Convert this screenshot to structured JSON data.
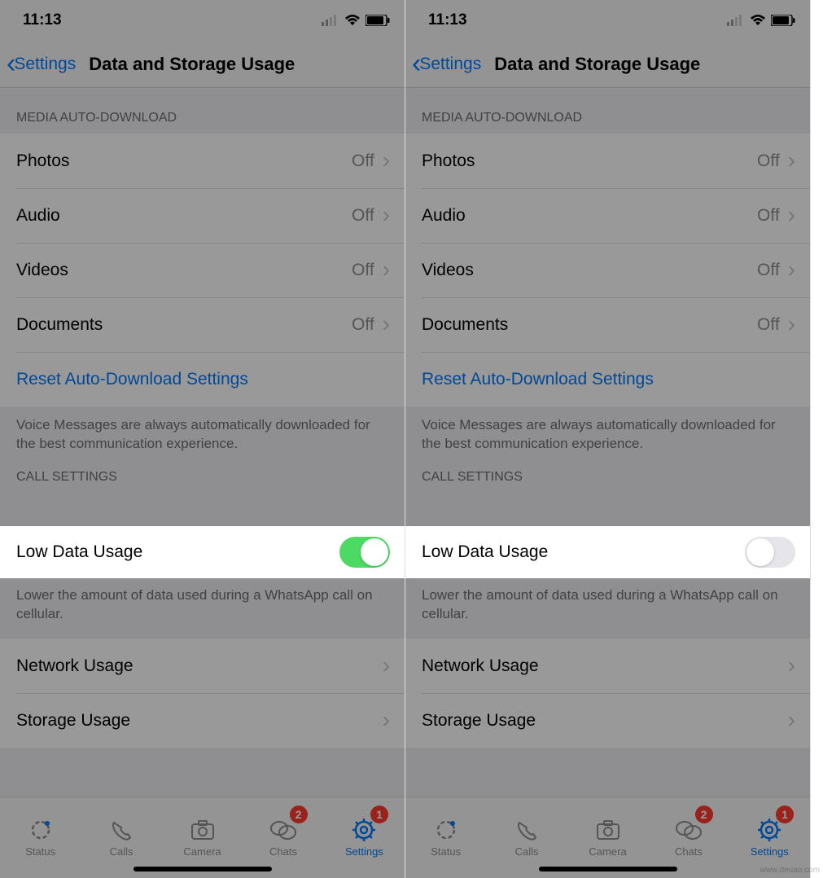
{
  "statusTime": "11:13",
  "nav": {
    "back": "Settings",
    "title": "Data and Storage Usage"
  },
  "sections": {
    "media": {
      "header": "Media Auto-Download",
      "photos": {
        "label": "Photos",
        "value": "Off"
      },
      "audio": {
        "label": "Audio",
        "value": "Off"
      },
      "videos": {
        "label": "Videos",
        "value": "Off"
      },
      "documents": {
        "label": "Documents",
        "value": "Off"
      },
      "reset": "Reset Auto-Download Settings",
      "note": "Voice Messages are always automatically downloaded for the best communication experience."
    },
    "call": {
      "header": "Call Settings",
      "lowData": "Low Data Usage",
      "note": "Lower the amount of data used during a WhatsApp call on cellular."
    },
    "usage": {
      "network": "Network Usage",
      "storage": "Storage Usage"
    }
  },
  "tabs": {
    "status": "Status",
    "calls": "Calls",
    "camera": "Camera",
    "chats": "Chats",
    "settings": "Settings",
    "badgeChats": "2",
    "badgeSettings": "1"
  },
  "screens": [
    {
      "lowDataOn": true
    },
    {
      "lowDataOn": false
    }
  ],
  "watermark": "www.deuao.com"
}
